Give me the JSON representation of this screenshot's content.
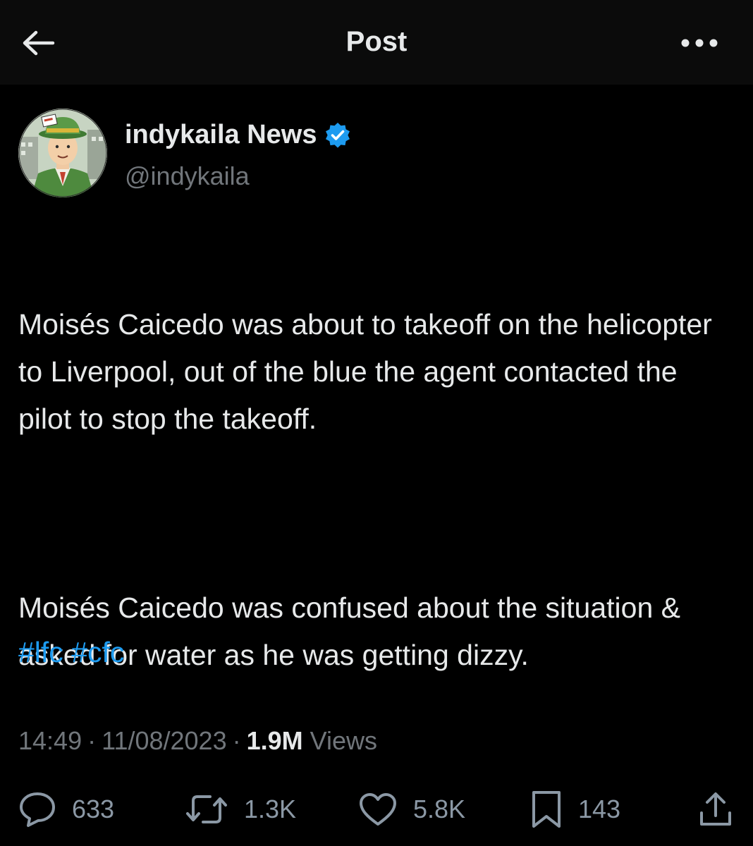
{
  "header": {
    "title": "Post",
    "back_icon": "arrow-left-icon",
    "more_icon": "more-horizontal-icon"
  },
  "author": {
    "display_name": "indykaila News",
    "handle": "@indykaila",
    "verified_icon": "verified-badge-icon",
    "verified_color": "#1d9bf0"
  },
  "tweet": {
    "paragraph_1": "Moisés Caicedo was about to takeoff on the helicopter to Liverpool, out of the blue the agent contacted the pilot to stop the takeoff.",
    "paragraph_2": "Moisés Caicedo was confused about the situation & asked for water as he was getting dizzy.",
    "hashtags": [
      "#lfc",
      "#cfc"
    ],
    "hashtag_color": "#1d9bf0"
  },
  "meta": {
    "time": "14:49",
    "separator": "·",
    "date": "11/08/2023",
    "views_count": "1.9M",
    "views_label": "Views"
  },
  "actions": {
    "reply": {
      "icon": "reply-icon",
      "count": "633"
    },
    "repost": {
      "icon": "repost-icon",
      "count": "1.3K"
    },
    "like": {
      "icon": "heart-icon",
      "count": "5.8K"
    },
    "bookmark": {
      "icon": "bookmark-icon",
      "count": "143"
    },
    "share": {
      "icon": "share-icon"
    }
  }
}
